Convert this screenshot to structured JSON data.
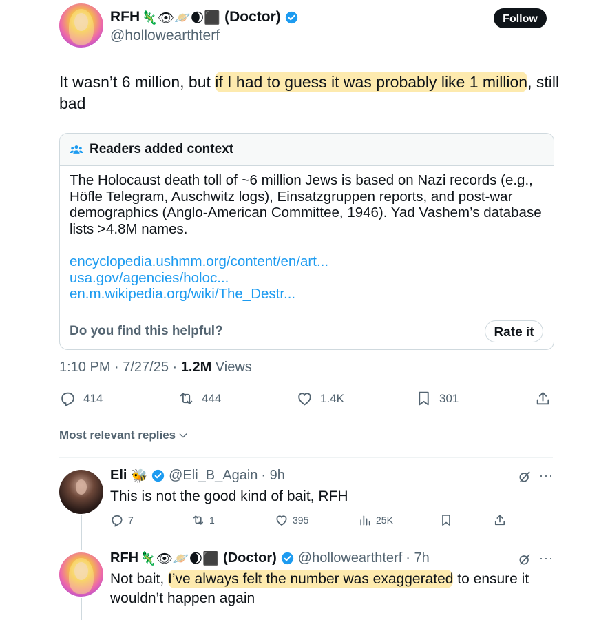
{
  "main_tweet": {
    "display_name": "RFH",
    "name_emojis": "🦎👁🪐🌒⬛",
    "name_suffix": "(Doctor)",
    "handle": "@hollowearthterf",
    "follow_label": "Follow",
    "text_plain_1": "It wasn’t 6 million, but ",
    "text_highlight": "if I had to guess it was probably like 1 million",
    "text_plain_2": ", still bad",
    "timestamp": "1:10 PM · 7/27/25 · ",
    "views_count": "1.2M",
    "views_label": " Views",
    "replies": "414",
    "reposts": "444",
    "likes": "1.4K",
    "bookmarks": "301"
  },
  "community_note": {
    "heading": "Readers added context",
    "body": "The Holocaust death toll of ~6 million Jews is based on Nazi records (e.g., Höfle Telegram, Auschwitz logs), Einsatzgruppen reports, and post-war demographics (Anglo-American Committee, 1946). Yad Vashem’s database lists >4.8M names.",
    "links": [
      "encyclopedia.ushmm.org/content/en/art...",
      "usa.gov/agencies/holoc...",
      "en.m.wikipedia.org/wiki/The_Destr..."
    ],
    "helpful_question": "Do you find this helpful?",
    "rate_label": "Rate it"
  },
  "sort_label": "Most relevant replies",
  "replies": [
    {
      "display_name": "Eli",
      "name_emojis": "🐝",
      "handle": "@Eli_B_Again",
      "time": "· 9h",
      "text": "This is not the good kind of bait, RFH",
      "replies": "7",
      "reposts": "1",
      "likes": "395",
      "views": "25K"
    },
    {
      "display_name": "RFH",
      "name_emojis": "🦎👁🪐🌒⬛",
      "name_suffix": "(Doctor)",
      "handle": "@hollowearthterf",
      "time": "· 7h",
      "text_plain_1": "Not bait, ",
      "text_highlight": "I’ve always felt the number was exaggerated",
      "text_plain_2": " to ensure it wouldn’t happen again"
    }
  ],
  "colors": {
    "verified": "#1d9bf0",
    "link": "#1d9bf0",
    "highlight": "#fcd96c",
    "secondary_text": "#536471"
  }
}
